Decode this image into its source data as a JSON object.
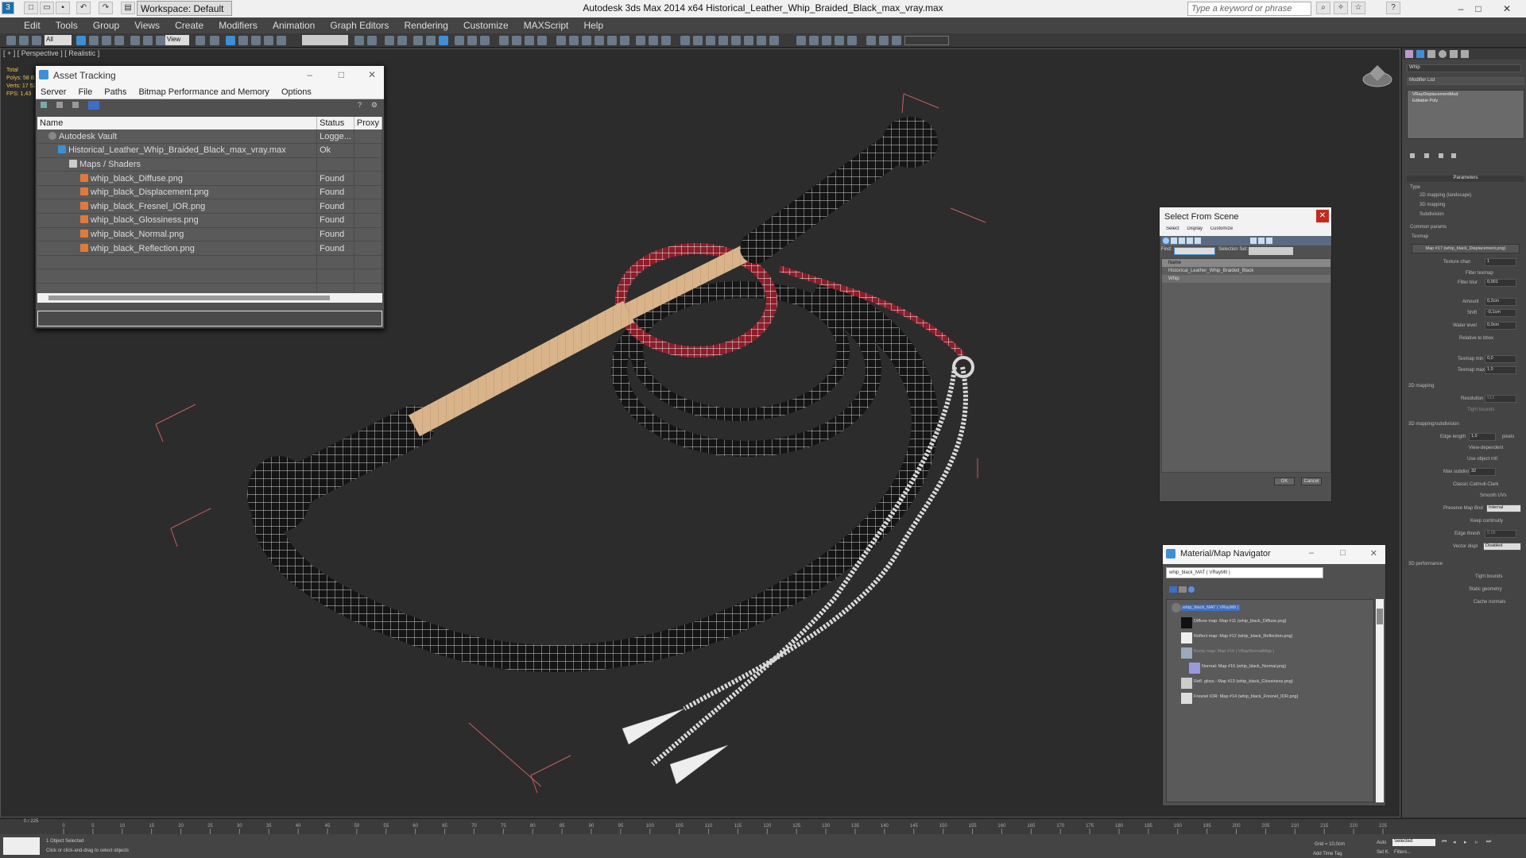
{
  "window": {
    "title": "Autodesk 3ds Max  2014 x64     Historical_Leather_Whip_Braided_Black_max_vray.max",
    "workspace": "Workspace: Default",
    "search_placeholder": "Type a keyword or phrase"
  },
  "menu": [
    "Edit",
    "Tools",
    "Group",
    "Views",
    "Create",
    "Modifiers",
    "Animation",
    "Graph Editors",
    "Rendering",
    "Customize",
    "MAXScript",
    "Help"
  ],
  "toolbar": {
    "selection_filter": "All",
    "view": "View"
  },
  "viewport": {
    "label": "[ + ] [ Perspective ] [ Realistic ]",
    "stats": [
      "Total",
      "Polys:  58 833",
      "Verts:  17 526",
      "",
      "FPS:    1,43"
    ]
  },
  "asset_tracking": {
    "title": "Asset Tracking",
    "menus": [
      "Server",
      "File",
      "Paths",
      "Bitmap Performance and Memory",
      "Options"
    ],
    "columns": [
      "Name",
      "Status",
      "Proxy"
    ],
    "rows": [
      {
        "name": "Autodesk Vault",
        "status": "Logge...",
        "indent": 0,
        "kind": "vault"
      },
      {
        "name": "Historical_Leather_Whip_Braided_Black_max_vray.max",
        "status": "Ok",
        "indent": 1,
        "kind": "max"
      },
      {
        "name": "Maps / Shaders",
        "status": "",
        "indent": 2,
        "kind": "folder"
      },
      {
        "name": "whip_black_Diffuse.png",
        "status": "Found",
        "indent": 3,
        "kind": "map"
      },
      {
        "name": "whip_black_Displacement.png",
        "status": "Found",
        "indent": 3,
        "kind": "map"
      },
      {
        "name": "whip_black_Fresnel_IOR.png",
        "status": "Found",
        "indent": 3,
        "kind": "map"
      },
      {
        "name": "whip_black_Glossiness.png",
        "status": "Found",
        "indent": 3,
        "kind": "map"
      },
      {
        "name": "whip_black_Normal.png",
        "status": "Found",
        "indent": 3,
        "kind": "map"
      },
      {
        "name": "whip_black_Reflection.png",
        "status": "Found",
        "indent": 3,
        "kind": "map"
      }
    ]
  },
  "select_from_scene": {
    "title": "Select From Scene",
    "menus": [
      "Select",
      "Display",
      "Customize"
    ],
    "find_label": "Find:",
    "selection_set_label": "Selection Set:",
    "list_header": "Name",
    "items": [
      "Historical_Leather_Whip_Braided_Black",
      "Whip"
    ],
    "ok": "OK",
    "cancel": "Cancel"
  },
  "material_navigator": {
    "title": "Material/Map Navigator",
    "field": "whip_black_MAT  ( VRayMtl )",
    "tree": [
      "whip_black_MAT  ( VRayMtl )",
      "Diffuse map: Map #11 (whip_black_Diffuse.png)",
      "Reflect map: Map #12 (whip_black_Reflection.png)",
      "Bump map: Map #16 ( VRayNormalMap )",
      "Normal: Map #16 (whip_black_Normal.png)",
      "Refl. gloss.: Map #13 (whip_black_Glossiness.png)",
      "Fresnel IOR: Map #14 (whip_black_Fresnel_IOR.png)"
    ]
  },
  "command_panel": {
    "object_name": "Whip",
    "modifier_list": "Modifier List",
    "stack": [
      "VRayDisplacementMod",
      "Editable Poly"
    ],
    "rollout_title": "Parameters",
    "type_label": "Type",
    "types": [
      "2D mapping (landscape)",
      "3D mapping",
      "Subdivision"
    ],
    "common_label": "Common params",
    "texmap_label": "Texmap",
    "texmap_button": "Map #17 (whip_black_Displacement.png)",
    "params": [
      {
        "label": "Texture chan",
        "value": "1"
      },
      {
        "label": "Filter texmap",
        "value": ""
      },
      {
        "label": "Filter blur",
        "value": "0,001"
      },
      {
        "label": "Amount",
        "value": "0,2cm"
      },
      {
        "label": "Shift",
        "value": "-0,1cm"
      },
      {
        "label": "Water level",
        "value": "0,0cm"
      },
      {
        "label": "Relative to bbox",
        "value": ""
      },
      {
        "label": "Texmap min",
        "value": "0,0"
      },
      {
        "label": "Texmap max",
        "value": "1,0"
      }
    ],
    "section_2d": "2D mapping",
    "resolution_label": "Resolution",
    "resolution_value": "512",
    "tight_bounds": "Tight bounds",
    "section_3d": "3D mapping/subdivision",
    "edge_length_label": "Edge length",
    "edge_length_value": "1,0",
    "pixels": "pixels",
    "view_dependent": "View-dependent",
    "use_object_mtl": "Use object mtl",
    "max_subdivs_label": "Max subdivs",
    "max_subdivs_value": "32",
    "classic_cc": "Classic Catmull-Clark",
    "smooth_uvs": "Smooth UVs",
    "preserve_map_bnd": "Preserve Map Bnd",
    "preserve_value": "Internal",
    "keep_continuity": "Keep continuity",
    "edge_thresh": "Edge thresh",
    "edge_thresh_value": "0,05",
    "vector_displ": "Vector displ",
    "vector_value": "Disabled",
    "section_perf": "3D performance",
    "static_geometry": "Static geometry",
    "cache_normals": "Cache normals"
  },
  "timeline": {
    "frame": "0 / 225",
    "ticks": [
      "0",
      "5",
      "10",
      "15",
      "20",
      "25",
      "30",
      "35",
      "40",
      "45",
      "50",
      "55",
      "60",
      "65",
      "70",
      "75",
      "80",
      "85",
      "90",
      "95",
      "100",
      "105",
      "110",
      "115",
      "120",
      "125",
      "130",
      "135",
      "140",
      "145",
      "150",
      "155",
      "160",
      "165",
      "170",
      "175",
      "180",
      "185",
      "190",
      "195",
      "200",
      "205",
      "210",
      "215",
      "220",
      "225"
    ]
  },
  "status": {
    "objects": "1 Object Selected",
    "prompt": "Click or click-and-drag to select objects",
    "grid": "Grid = 10,0cm",
    "auto_key": "Auto",
    "selected": "Selected",
    "set_key": "Set K.",
    "filters": "Filters...",
    "add_time_tag": "Add Time Tag"
  },
  "colors": {
    "accent": "#3d8fd6",
    "wire_red": "#8b1e2a",
    "handle": "#d9b48a",
    "close_red": "#c42b1c"
  }
}
